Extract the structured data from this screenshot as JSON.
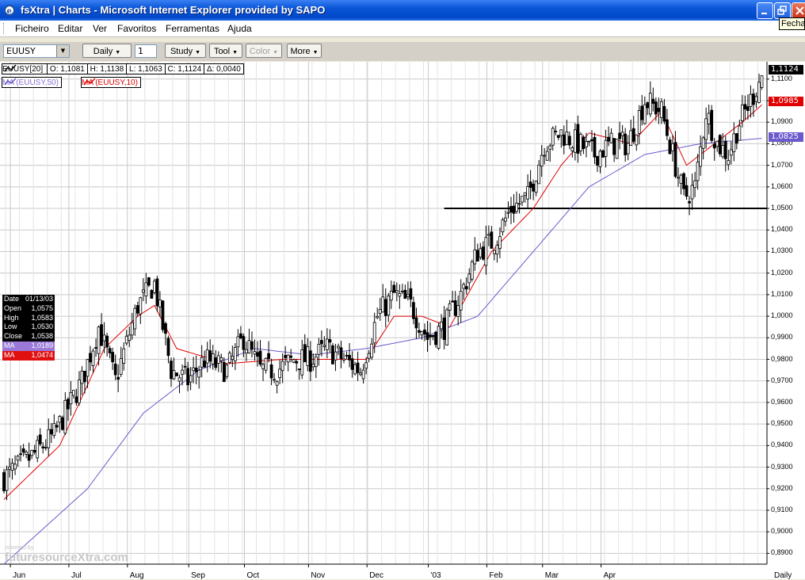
{
  "window": {
    "title": "fsXtra | Charts - Microsoft Internet Explorer provided by SAPO",
    "tooltip": "Fechar"
  },
  "menu": [
    "Ficheiro",
    "Editar",
    "Ver",
    "Favoritos",
    "Ferramentas",
    "Ajuda"
  ],
  "toolbar": {
    "symbol": "EUUSY",
    "interval": "Daily",
    "period": "1",
    "study": "Study",
    "tool": "Tool",
    "color": "Color",
    "more": "More"
  },
  "legend": {
    "main": "EUUSY[20]",
    "open": "O: 1,1081",
    "high": "H: 1,1138",
    "low": "L: 1,1063",
    "close": "C: 1,1124",
    "delta": "Δ: 0,0040",
    "ma50": "MA (EUUSY,50)",
    "ma10": "MA (EUUSY,10)"
  },
  "datebox": {
    "date": "01/13/03",
    "open": "1,0575",
    "high": "1,0583",
    "low": "1,0530",
    "close": "1,0538",
    "ma1": "1,0189",
    "ma2": "1,0474",
    "labels": {
      "date": "Date",
      "open": "Open",
      "high": "High",
      "low": "Low",
      "close": "Close",
      "ma": "MA"
    }
  },
  "price_tags": {
    "last": "1,1124",
    "ma10": "1,0985",
    "ma50": "1,0825"
  },
  "colors": {
    "ma10": "#e00000",
    "ma50": "#6a5acd",
    "candle": "#000000",
    "support": "#000000"
  },
  "watermark": {
    "small": "powered by",
    "big": "futuresourceXtra.com"
  },
  "chart_data": {
    "type": "candlestick",
    "symbol": "EUUSY",
    "interval": "Daily",
    "y_tick_labels": [
      "0,8900",
      "0,9000",
      "0,9100",
      "0,9200",
      "0,9300",
      "0,9400",
      "0,9500",
      "0,9600",
      "0,9700",
      "0,9800",
      "0,9900",
      "1,0000",
      "1,0100",
      "1,0200",
      "1,0300",
      "1,0400",
      "1,0500",
      "1,0600",
      "1,0700",
      "1,0800",
      "1,0900",
      "1,1000",
      "1,1100"
    ],
    "x_tick_labels": [
      "Jun",
      "Jul",
      "Aug",
      "Sep",
      "Oct",
      "Nov",
      "Dec",
      "'03",
      "Feb",
      "Mar",
      "Apr",
      "Daily"
    ],
    "ylim": [
      0.885,
      1.118
    ],
    "support_level": 1.05,
    "series": [
      {
        "name": "EUUSY",
        "kind": "ohlc",
        "close_anchors": [
          [
            0,
            0.925
          ],
          [
            10,
            0.935
          ],
          [
            18,
            0.945
          ],
          [
            28,
            0.97
          ],
          [
            34,
            0.995
          ],
          [
            40,
            0.97
          ],
          [
            48,
            1.005
          ],
          [
            54,
            1.015
          ],
          [
            60,
            0.975
          ],
          [
            66,
            0.97
          ],
          [
            72,
            0.98
          ],
          [
            80,
            0.975
          ],
          [
            86,
            0.99
          ],
          [
            92,
            0.975
          ],
          [
            98,
            0.975
          ],
          [
            104,
            0.98
          ],
          [
            110,
            0.98
          ],
          [
            116,
            0.985
          ],
          [
            122,
            0.98
          ],
          [
            128,
            0.975
          ],
          [
            134,
            1.0
          ],
          [
            140,
            1.01
          ],
          [
            146,
            1.005
          ],
          [
            152,
            0.99
          ],
          [
            158,
            0.995
          ],
          [
            164,
            1.01
          ],
          [
            170,
            1.03
          ],
          [
            176,
            1.035
          ],
          [
            182,
            1.05
          ],
          [
            188,
            1.055
          ],
          [
            194,
            1.08
          ],
          [
            200,
            1.085
          ],
          [
            206,
            1.08
          ],
          [
            212,
            1.075
          ],
          [
            218,
            1.08
          ],
          [
            224,
            1.08
          ],
          [
            230,
            1.1
          ],
          [
            236,
            1.095
          ],
          [
            240,
            1.075
          ],
          [
            244,
            1.055
          ],
          [
            248,
            1.06
          ],
          [
            252,
            1.095
          ],
          [
            256,
            1.08
          ],
          [
            260,
            1.075
          ],
          [
            264,
            1.09
          ],
          [
            268,
            1.1
          ],
          [
            272,
            1.112
          ]
        ]
      },
      {
        "name": "MA (EUUSY,10)",
        "kind": "line",
        "values_anchors": [
          [
            0,
            0.915
          ],
          [
            20,
            0.94
          ],
          [
            36,
            0.985
          ],
          [
            48,
            1.0
          ],
          [
            54,
            1.005
          ],
          [
            62,
            0.985
          ],
          [
            80,
            0.978
          ],
          [
            100,
            0.98
          ],
          [
            120,
            0.98
          ],
          [
            130,
            0.98
          ],
          [
            140,
            1.0
          ],
          [
            150,
            1.0
          ],
          [
            160,
            0.995
          ],
          [
            175,
            1.03
          ],
          [
            190,
            1.05
          ],
          [
            200,
            1.07
          ],
          [
            210,
            1.085
          ],
          [
            225,
            1.08
          ],
          [
            236,
            1.095
          ],
          [
            245,
            1.07
          ],
          [
            255,
            1.08
          ],
          [
            265,
            1.09
          ],
          [
            272,
            1.098
          ]
        ]
      },
      {
        "name": "MA (EUUSY,50)",
        "kind": "line",
        "values_anchors": [
          [
            0,
            0.885
          ],
          [
            30,
            0.92
          ],
          [
            50,
            0.955
          ],
          [
            70,
            0.975
          ],
          [
            90,
            0.985
          ],
          [
            110,
            0.982
          ],
          [
            130,
            0.985
          ],
          [
            150,
            0.99
          ],
          [
            170,
            1.0
          ],
          [
            190,
            1.03
          ],
          [
            210,
            1.06
          ],
          [
            230,
            1.075
          ],
          [
            250,
            1.08
          ],
          [
            272,
            1.0825
          ]
        ]
      }
    ]
  }
}
